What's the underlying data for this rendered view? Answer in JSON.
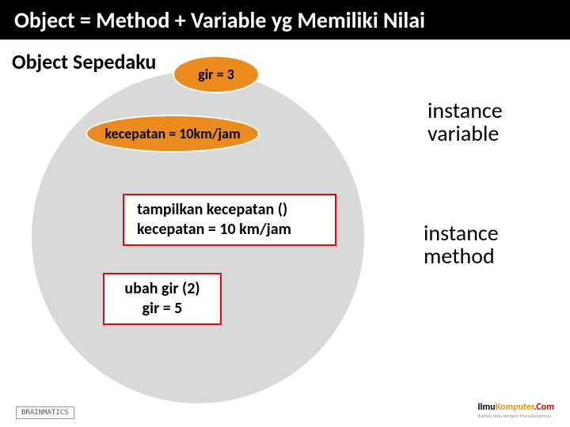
{
  "title": "Object = Method + Variable yg Memiliki Nilai",
  "subtitle": "Object Sepedaku",
  "circle": {
    "gir": "gir = 3",
    "kecepatan": "kecepatan = 10km/jam",
    "tampilkan_line1": "tampilkan kecepatan ()",
    "tampilkan_line2": "kecepatan = 10 km/jam",
    "ubah_line1": "ubah gir (2)",
    "ubah_line2": "gir = 5"
  },
  "labels": {
    "instance_variable_l1": "instance",
    "instance_variable_l2": "variable",
    "instance_method_l1": "instance",
    "instance_method_l2": "method"
  },
  "footer": {
    "left": "BRAINMATICS",
    "right_ilmu": "Ilmu",
    "right_komputer": "Komputer",
    "right_com": ".Com",
    "right_sub": "Ikatlah Ilmu dengan Menuliskannya"
  }
}
